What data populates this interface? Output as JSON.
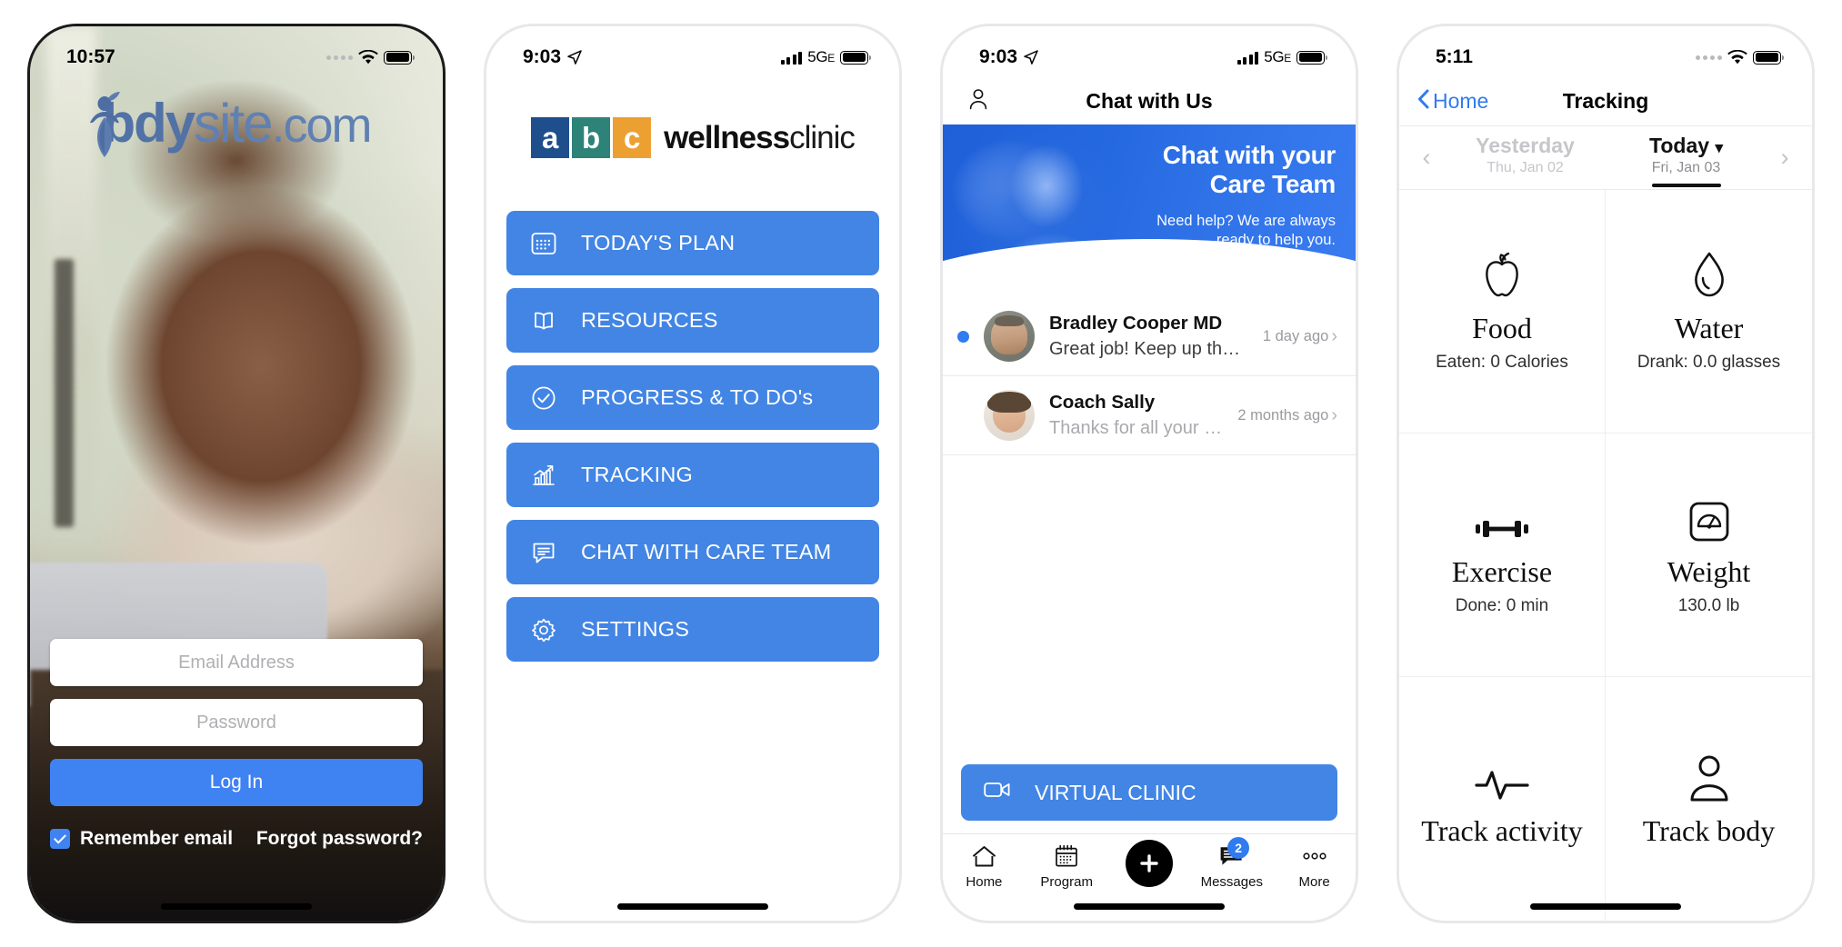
{
  "phone1": {
    "status": {
      "time": "10:57",
      "wifi_icon": "wifi-icon",
      "battery_icon": "battery-icon",
      "dots_icon": "signal-dots-icon"
    },
    "logo": {
      "brand_bold": "b",
      "brand_mid": "dy",
      "brand_light": "site",
      "domain": ".com",
      "person_icon": "bodysite-person-icon"
    },
    "form": {
      "email_placeholder": "Email Address",
      "password_placeholder": "Password",
      "login_label": "Log In",
      "remember_label": "Remember email",
      "forgot_label": "Forgot password?",
      "remember_checked": true
    },
    "accent": "#3f82f2"
  },
  "phone2": {
    "status": {
      "time": "9:03",
      "location_icon": "location-arrow-icon",
      "network": "5G",
      "network_sub": "E",
      "bars_icon": "cell-bars-icon",
      "battery_icon": "battery-icon"
    },
    "clinic": {
      "tiles": [
        {
          "letter": "a",
          "color": "#1f4e8c"
        },
        {
          "letter": "b",
          "color": "#2d8378"
        },
        {
          "letter": "c",
          "color": "#eda032"
        }
      ],
      "name_bold": "wellness",
      "name_light": "clinic"
    },
    "menu": [
      {
        "label": "TODAY'S PLAN",
        "icon": "calendar-grid-icon"
      },
      {
        "label": "RESOURCES",
        "icon": "open-book-icon"
      },
      {
        "label": "PROGRESS & TO DO's",
        "icon": "check-circle-icon"
      },
      {
        "label": "TRACKING",
        "icon": "bar-chart-trend-icon"
      },
      {
        "label": "CHAT WITH CARE TEAM",
        "icon": "chat-lines-icon"
      },
      {
        "label": "SETTINGS",
        "icon": "gear-icon"
      }
    ],
    "button_color": "#4285e4"
  },
  "phone3": {
    "status": {
      "time": "9:03",
      "location_icon": "location-arrow-icon",
      "network": "5G",
      "network_sub": "E",
      "bars_icon": "cell-bars-icon",
      "battery_icon": "battery-icon"
    },
    "navbar": {
      "title": "Chat with Us",
      "profile_icon": "person-outline-icon"
    },
    "hero": {
      "heading_line1": "Chat with your",
      "heading_line2": "Care Team",
      "sub_line1": "Need help? We are always",
      "sub_line2": "ready to help you."
    },
    "conversations": [
      {
        "name": "Bradley Cooper MD",
        "preview": "Great job! Keep up the good w…",
        "time": "1 day ago",
        "unread": true,
        "avatar": "avatar-bradley-cooper"
      },
      {
        "name": "Coach Sally",
        "preview": "Thanks for all your help!",
        "time": "2 months ago",
        "unread": false,
        "avatar": "avatar-coach-sally"
      }
    ],
    "virtual_clinic": {
      "label": "VIRTUAL CLINIC",
      "icon": "video-camera-icon"
    },
    "tabs": [
      {
        "label": "Home",
        "icon": "home-icon",
        "badge": ""
      },
      {
        "label": "Program",
        "icon": "calendar-icon",
        "badge": ""
      },
      {
        "label": "",
        "icon": "plus-fab-icon",
        "badge": ""
      },
      {
        "label": "Messages",
        "icon": "messages-icon",
        "badge": "2"
      },
      {
        "label": "More",
        "icon": "more-dots-icon",
        "badge": ""
      }
    ],
    "accent": "#2f7bef"
  },
  "phone4": {
    "status": {
      "time": "5:11",
      "wifi_icon": "wifi-icon",
      "battery_icon": "battery-icon",
      "dots_icon": "signal-dots-icon"
    },
    "navbar": {
      "back_label": "Home",
      "back_icon": "chevron-left-icon",
      "title": "Tracking"
    },
    "dates": {
      "prev_icon": "chevron-left-icon",
      "next_icon": "chevron-right-icon",
      "yesterday": {
        "label": "Yesterday",
        "sub": "Thu, Jan 02"
      },
      "today": {
        "label": "Today",
        "sub": "Fri, Jan 03",
        "caret_icon": "chevron-down-icon"
      }
    },
    "tiles": [
      {
        "title": "Food",
        "value": "Eaten: 0 Calories",
        "icon": "apple-icon"
      },
      {
        "title": "Water",
        "value": "Drank: 0.0 glasses",
        "icon": "water-drop-icon"
      },
      {
        "title": "Exercise",
        "value": "Done: 0 min",
        "icon": "dumbbell-icon"
      },
      {
        "title": "Weight",
        "value": "130.0 lb",
        "icon": "scale-icon"
      },
      {
        "title": "Track activity",
        "value": "",
        "icon": "heartbeat-icon"
      },
      {
        "title": "Track body",
        "value": "",
        "icon": "person-icon"
      }
    ]
  }
}
